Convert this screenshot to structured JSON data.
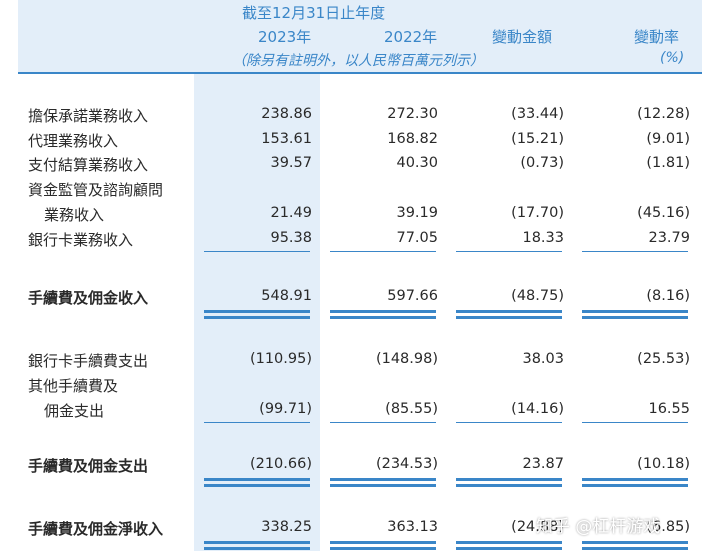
{
  "header": {
    "period": "截至12月31日止年度",
    "col_2023": "2023年",
    "col_2022": "2022年",
    "col_change_amt": "變動金額",
    "col_change_rate": "變動率",
    "unit_note": "（除另有註明外，以人民幣百萬元列示）",
    "rate_unit": "(%)"
  },
  "rows": [
    {
      "label": "擔保承諾業務收入",
      "v2023": "238.86",
      "v2022": "272.30",
      "chg": "(33.44)",
      "rate": "(12.28)"
    },
    {
      "label": "代理業務收入",
      "v2023": "153.61",
      "v2022": "168.82",
      "chg": "(15.21)",
      "rate": "(9.01)"
    },
    {
      "label": "支付結算業務收入",
      "v2023": "39.57",
      "v2022": "40.30",
      "chg": "(0.73)",
      "rate": "(1.81)"
    },
    {
      "label": "資金監管及諮詢顧問",
      "label2": "業務收入",
      "v2023": "21.49",
      "v2022": "39.19",
      "chg": "(17.70)",
      "rate": "(45.16)"
    },
    {
      "label": "銀行卡業務收入",
      "v2023": "95.38",
      "v2022": "77.05",
      "chg": "18.33",
      "rate": "23.79"
    },
    {
      "label": "手續費及佣金收入",
      "v2023": "548.91",
      "v2022": "597.66",
      "chg": "(48.75)",
      "rate": "(8.16)"
    },
    {
      "label": "銀行卡手續費支出",
      "v2023": "(110.95)",
      "v2022": "(148.98)",
      "chg": "38.03",
      "rate": "(25.53)"
    },
    {
      "label": "其他手續費及",
      "label2": "佣金支出",
      "v2023": "(99.71)",
      "v2022": "(85.55)",
      "chg": "(14.16)",
      "rate": "16.55"
    },
    {
      "label": "手續費及佣金支出",
      "v2023": "(210.66)",
      "v2022": "(234.53)",
      "chg": "23.87",
      "rate": "(10.18)"
    },
    {
      "label": "手續費及佣金淨收入",
      "v2023": "338.25",
      "v2022": "363.13",
      "chg": "(24.88)",
      "rate": "(6.85)"
    }
  ],
  "watermark": "知乎 @杠杆游戏",
  "colors": {
    "accent": "#3a86c8",
    "band": "#e3eef9"
  }
}
